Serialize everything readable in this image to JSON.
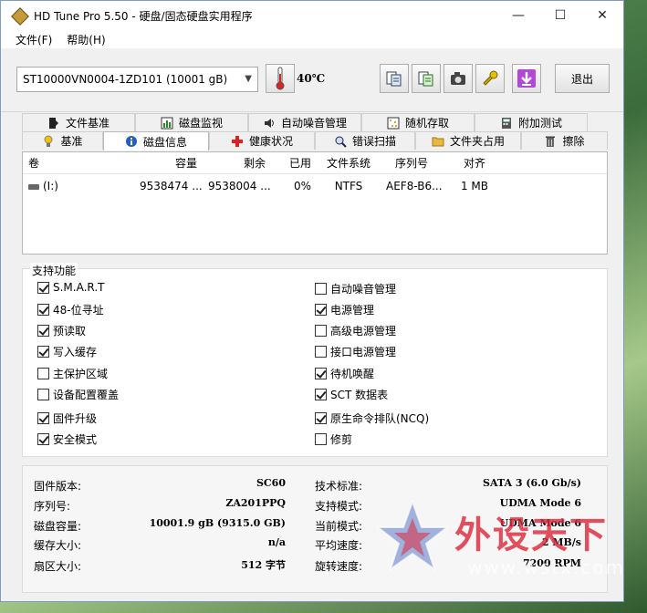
{
  "window": {
    "title": "HD Tune Pro 5.50 - 硬盘/固态硬盘实用程序"
  },
  "menu": {
    "file": "文件(F)",
    "help": "帮助(H)"
  },
  "toolbar": {
    "drive": "ST10000VN0004-1ZD101 (10001 gB)",
    "temperature": "40℃",
    "exit_label": "退出"
  },
  "tabs_top": [
    {
      "label": "文件基准",
      "icon": "folder-bench-icon"
    },
    {
      "label": "磁盘监视",
      "icon": "monitor-chart-icon"
    },
    {
      "label": "自动噪音管理",
      "icon": "speaker-icon"
    },
    {
      "label": "随机存取",
      "icon": "random-dots-icon"
    },
    {
      "label": "附加测试",
      "icon": "calculator-icon"
    }
  ],
  "tabs_bottom": [
    {
      "label": "基准",
      "icon": "bulb-icon"
    },
    {
      "label": "磁盘信息",
      "icon": "info-icon",
      "active": true
    },
    {
      "label": "健康状况",
      "icon": "health-cross-icon"
    },
    {
      "label": "错误扫描",
      "icon": "magnifier-icon"
    },
    {
      "label": "文件夹占用",
      "icon": "folder-icon"
    },
    {
      "label": "擦除",
      "icon": "trash-icon"
    }
  ],
  "volumes": {
    "headers": [
      "卷",
      "容量",
      "剩余",
      "已用",
      "文件系统",
      "序列号",
      "对齐"
    ],
    "rows": [
      [
        "(I:)",
        "9538474 ...",
        "9538004 ...",
        "0%",
        "NTFS",
        "AEF8-B6...",
        "1 MB"
      ]
    ]
  },
  "features": {
    "title": "支持功能",
    "left": [
      {
        "label": "S.M.A.R.T",
        "checked": true
      },
      {
        "label": "48-位寻址",
        "checked": true
      },
      {
        "label": "预读取",
        "checked": true
      },
      {
        "label": "写入缓存",
        "checked": true
      },
      {
        "label": "主保护区域",
        "checked": false
      },
      {
        "label": "设备配置覆盖",
        "checked": false
      },
      {
        "label": "固件升级",
        "checked": true
      },
      {
        "label": "安全模式",
        "checked": true
      }
    ],
    "right": [
      {
        "label": "自动噪音管理",
        "checked": false
      },
      {
        "label": "电源管理",
        "checked": true
      },
      {
        "label": "高级电源管理",
        "checked": false
      },
      {
        "label": "接口电源管理",
        "checked": false
      },
      {
        "label": "待机唤醒",
        "checked": true
      },
      {
        "label": "SCT 数据表",
        "checked": true
      },
      {
        "label": "原生命令排队(NCQ)",
        "checked": true
      },
      {
        "label": "修剪",
        "checked": false
      }
    ]
  },
  "info": {
    "left": [
      {
        "label": "固件版本:",
        "value": "SC60"
      },
      {
        "label": "序列号:",
        "value": "ZA201PPQ"
      },
      {
        "label": "磁盘容量:",
        "value": "10001.9 gB (9315.0 GB)"
      },
      {
        "label": "缓存大小:",
        "value": "n/a"
      },
      {
        "label": "扇区大小:",
        "value": "512 字节"
      }
    ],
    "right": [
      {
        "label": "技术标准:",
        "value": "SATA 3 (6.0 Gb/s)"
      },
      {
        "label": "支持模式:",
        "value": "UDMA Mode 6"
      },
      {
        "label": "当前模式:",
        "value": "UDMA Mode 6"
      },
      {
        "label": "平均速度:",
        "value": "2 MB/s"
      },
      {
        "label": "旋转速度:",
        "value": "7200 RPM"
      }
    ]
  },
  "watermark": {
    "text": "外设天下",
    "url": "www.wstx.com"
  }
}
